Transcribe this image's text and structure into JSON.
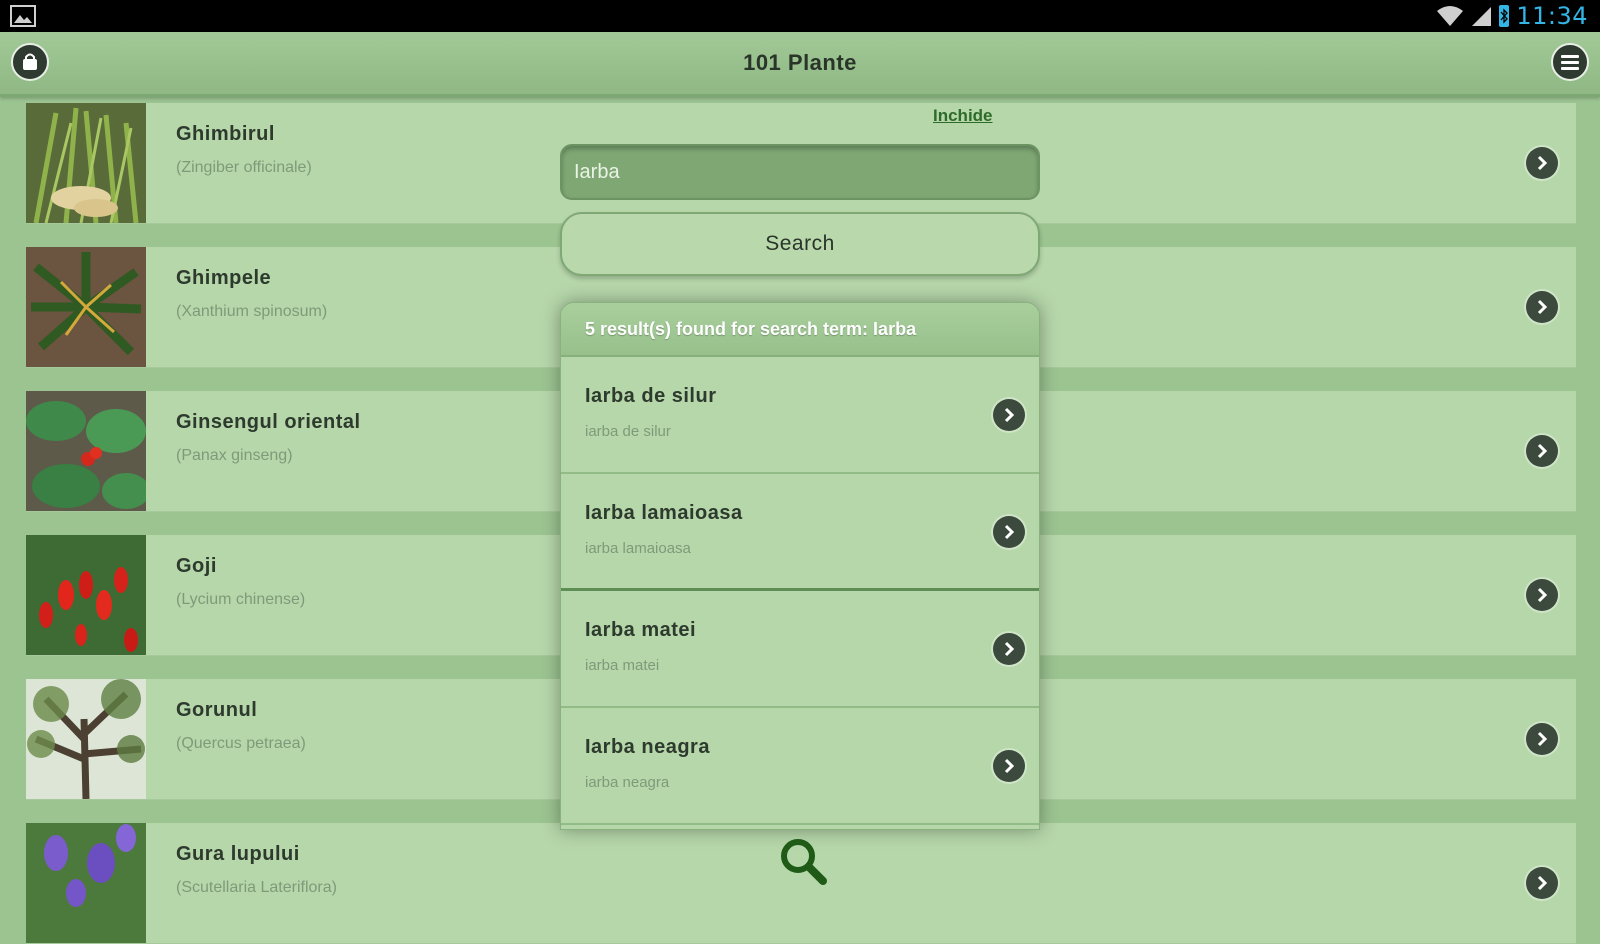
{
  "status_bar": {
    "time": "11:34"
  },
  "action_bar": {
    "title": "101 Plante"
  },
  "plants": [
    {
      "name": "Ghimbirul",
      "latin": "(Zingiber officinale)"
    },
    {
      "name": "Ghimpele",
      "latin": "(Xanthium spinosum)"
    },
    {
      "name": "Ginsengul oriental",
      "latin": "(Panax ginseng)"
    },
    {
      "name": "Goji",
      "latin": "(Lycium chinense)"
    },
    {
      "name": "Gorunul",
      "latin": "(Quercus petraea)"
    },
    {
      "name": "Gura lupului",
      "latin": "(Scutellaria Lateriflora)"
    }
  ],
  "search": {
    "close_label": "Inchide",
    "value": "Iarba",
    "button_label": "Search",
    "results_header": "5 result(s) found for search term: Iarba",
    "results": [
      {
        "title": "Iarba de silur",
        "subtitle": "iarba de silur"
      },
      {
        "title": "Iarba lamaioasa",
        "subtitle": "iarba lamaioasa"
      },
      {
        "title": "Iarba matei",
        "subtitle": "iarba matei"
      },
      {
        "title": "Iarba neagra",
        "subtitle": "iarba neagra"
      }
    ]
  },
  "icons": {
    "left_action": "shopping-bag-icon",
    "right_action": "menu-icon",
    "row_action": "chevron-right-icon",
    "search": "search-icon"
  },
  "colors": {
    "background": "#9cc491",
    "row": "#b6d7aa",
    "accent_dark": "#2f3b30",
    "status_blue": "#33b5e5",
    "search_icon": "#1f5a17"
  }
}
